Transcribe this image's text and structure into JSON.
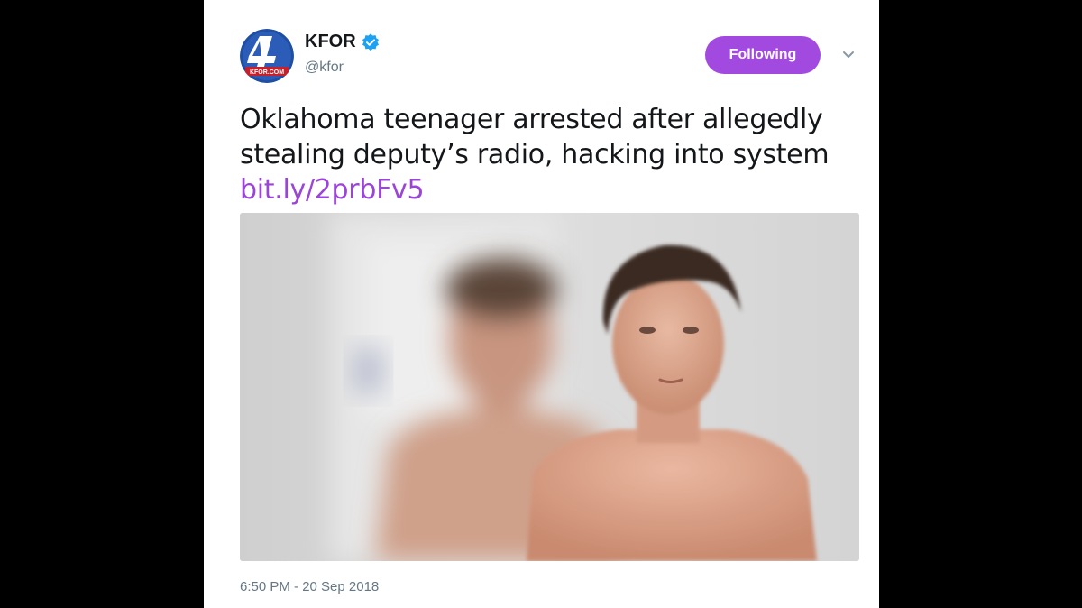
{
  "tweet": {
    "display_name": "KFOR",
    "handle": "@kfor",
    "avatar_icon": "kfor-4-logo-icon",
    "avatar_logo_text": "4 KFOR.COM",
    "verified_icon": "verified-badge-icon",
    "follow_button_label": "Following",
    "menu_icon": "chevron-down-icon",
    "text_lines": [
      "Oklahoma teenager arrested after allegedly",
      "stealing deputy’s radio, hacking into system"
    ],
    "link": "bit.ly/2prbFv5",
    "media_description_icon": "photo",
    "timestamp": "6:50 PM - 20 Sep 2018"
  },
  "colors": {
    "accent_purple": "#a24ae0",
    "link_purple": "#9b45d8",
    "verified_blue": "#1da1f2",
    "text_dark": "#14171a",
    "text_muted": "#657786",
    "background": "#000000",
    "card": "#ffffff"
  }
}
